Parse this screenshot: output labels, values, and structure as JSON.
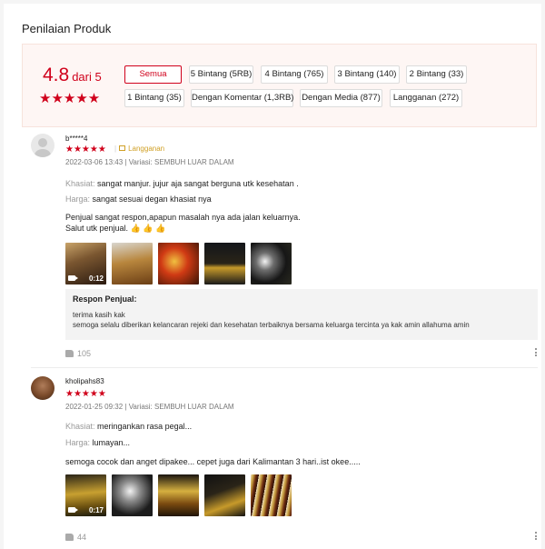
{
  "section_title": "Penilaian Produk",
  "summary": {
    "score": "4.8",
    "of_label": "dari 5",
    "stars": "★★★★★",
    "filters": [
      {
        "label": "Semua",
        "active": true
      },
      {
        "label": "5 Bintang (5RB)",
        "active": false
      },
      {
        "label": "4 Bintang (765)",
        "active": false
      },
      {
        "label": "3 Bintang (140)",
        "active": false
      },
      {
        "label": "2 Bintang (33)",
        "active": false
      },
      {
        "label": "1 Bintang (35)",
        "active": false
      },
      {
        "label": "Dengan Komentar (1,3RB)",
        "active": false
      },
      {
        "label": "Dengan Media (877)",
        "active": false
      },
      {
        "label": "Langganan (272)",
        "active": false
      }
    ]
  },
  "reviews": [
    {
      "username": "b*****4",
      "stars": "★★★★★",
      "badge_sep": "|",
      "badge": "Langganan",
      "meta": "2022-03-06 13:43 | Variasi: SEMBUH LUAR DALAM",
      "khasiat_label": "Khasiat:",
      "khasiat": "sangat manjur. jujur aja sangat berguna utk kesehatan .",
      "harga_label": "Harga:",
      "harga": "sangat sesuai degan khasiat nya",
      "comment_line1": "Penjual sangat respon,apapun masalah nya ada jalan keluarnya.",
      "comment_line2": "Salut utk penjual. 👍 👍 👍",
      "video_duration": "0:12",
      "response_title": "Respon Penjual:",
      "response_line1": "terima kasih kak",
      "response_line2": "semoga selalu diberikan kelancaran rejeki dan kesehatan terbaiknya bersama keluarga tercinta ya kak amin allahuma amin",
      "likes": "105"
    },
    {
      "username": "kholipahs83",
      "stars": "★★★★★",
      "meta": "2022-01-25 09:32 | Variasi: SEMBUH LUAR DALAM",
      "khasiat_label": "Khasiat:",
      "khasiat": "meringankan rasa pegal...",
      "harga_label": "Harga:",
      "harga": "lumayan...",
      "comment_line1": "semoga cocok dan anget dipakee... cepet juga dari Kalimantan 3 hari..ist okee.....",
      "video_duration": "0:17",
      "likes": "44"
    }
  ],
  "colors": {
    "accent": "#d0011b",
    "badge": "#d0a026"
  }
}
